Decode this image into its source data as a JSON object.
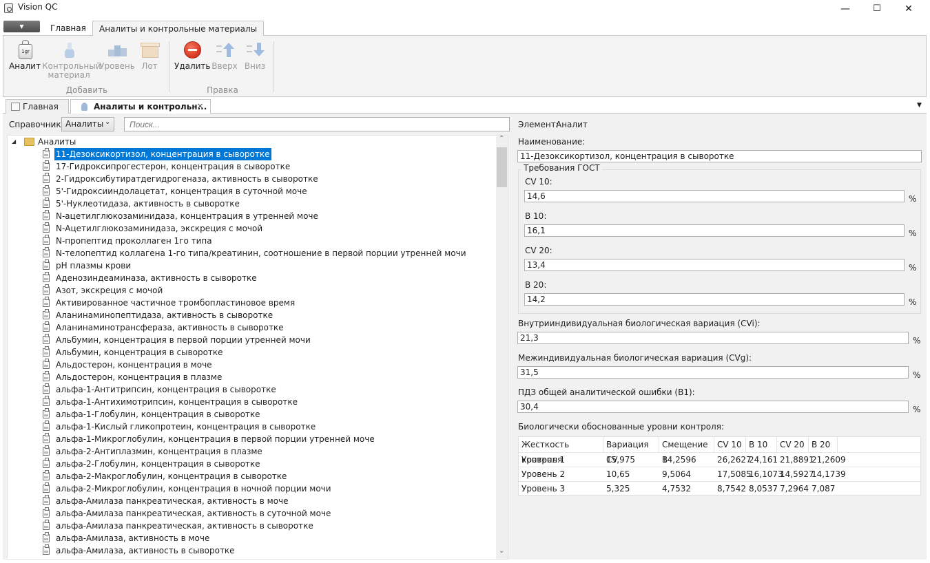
{
  "window": {
    "title": "Vision QC",
    "minimize": "—",
    "maximize": "☐",
    "close": "✕"
  },
  "ribbon": {
    "app_menu": "▼",
    "tabs": [
      "Главная",
      "Аналиты и контрольные материалы"
    ],
    "add_group": {
      "label": "Добавить",
      "buttons": {
        "analyte": "Аналит",
        "control_1": "Контрольный",
        "control_2": "материал",
        "level": "Уровень",
        "lot": "Лот"
      }
    },
    "edit_group": {
      "label": "Правка",
      "buttons": {
        "delete": "Удалить",
        "up": "Вверх",
        "down": "Вниз"
      }
    },
    "icon_text": "1gr"
  },
  "doc_tabs": {
    "home": "Главная",
    "analytes": "Аналиты и контрольн...",
    "close": "✕",
    "overflow": "▼"
  },
  "left": {
    "dict_label": "Справочник:",
    "dict_value": "Аналиты",
    "dict_arrow": "⌄",
    "search_placeholder": "Поиск...",
    "tree_root": "Аналиты",
    "tree_expander": "◢",
    "items": [
      "11-Дезоксикортизол, концентрация в сыворотке",
      "17-Гидроксипрогестерон, концентрация в сыворотке",
      "2-Гидроксибутиратдегидрогеназа, активность в сыворотке",
      "5'-Гидроксииндолацетат, концентрация в суточной моче",
      "5'-Нуклеотидаза, активность в сыворотке",
      "N-ацетилглюкозаминидаза, концентрация в утренней моче",
      "N-Ацетилглюкозаминидаза, экскреция с мочой",
      "N-пропептид проколлаген 1го типа",
      "N-телопептид коллагена 1-го  типа/креатинин, соотношение в первой порции утренней мочи",
      "pH плазмы крови",
      "Аденозиндеаминаза, активность в сыворотке",
      "Азот, экскреция с мочой",
      "Активированное частичное тромбопластиновое время",
      "Аланинаминопептидаза, активность в сыворотке",
      "Аланинаминотрансфераза, активность в сыворотке",
      "Альбумин, концентрация в первой порции утренней мочи",
      "Альбумин, концентрация в сыворотке",
      "Альдостерон, концентрация в моче",
      "Альдостерон, концентрация в плазме",
      "альфа-1-Антитрипсин, концентрация в сыворотке",
      "альфа-1-Антихимотрипсин, концентрация в сыворотке",
      "альфа-1-Глобулин, концентрация в сыворотке",
      "альфа-1-Кислый гликопротеин, концентрация в сыворотке",
      "альфа-1-Микроглобулин, концентрация в первой порции утренней моче",
      "альфа-2-Антиплазмин, концентрация в плазме",
      "альфа-2-Глобулин, концентрация в сыворотке",
      "альфа-2-Макроглобулин, концентрация в сыворотке",
      "альфа-2-Микроглобулин, концентрация в ночной порции мочи",
      "альфа-Амилаза панкреатическая, активность в моче",
      "альфа-Амилаза панкреатическая, активность в суточной моче",
      "альфа-Амилаза панкреатическая, активность в сыворотке",
      "альфа-Амилаза, активность в моче",
      "альфа-Амилаза, активность в сыворотке"
    ],
    "scroll_up": "⌃",
    "scroll_down": "⌄"
  },
  "right": {
    "element_label": "Элемент:",
    "element_value": "Аналит",
    "name_label": "Наименование:",
    "name_value": "11-Дезоксикортизол, концентрация в сыворотке",
    "gost_title": "Требования ГОСТ",
    "pct": "%",
    "cv10_label": "CV 10:",
    "cv10_value": "14,6",
    "b10_label": "B 10:",
    "b10_value": "16,1",
    "cv20_label": "CV 20:",
    "cv20_value": "13,4",
    "b20_label": "B 20:",
    "b20_value": "14,2",
    "cvi_label": "Внутрииндивидуальная биологическая вариация (CVi):",
    "cvi_value": "21,3",
    "cvg_label": "Межиндивидуальная биологическая вариация (CVg):",
    "cvg_value": "31,5",
    "b1_label": "ПДЗ общей аналитической ошибки (B1):",
    "b1_value": "30,4",
    "levels_label": "Биологически обоснованные уровни контроля:",
    "levels": {
      "headers": [
        "Жесткость контроля",
        "Вариация CV",
        "Смещение B",
        "CV 10",
        "B 10",
        "CV 20",
        "B 20"
      ],
      "rows": [
        [
          "Уровень 1",
          "15,975",
          "14,2596",
          "26,2627",
          "24,161",
          "21,8891",
          "21,2609"
        ],
        [
          "Уровень 2",
          "10,65",
          "9,5064",
          "17,5085",
          "16,1073",
          "14,5927",
          "14,1739"
        ],
        [
          "Уровень 3",
          "5,325",
          "4,7532",
          "8,7542",
          "8,0537",
          "7,2964",
          "7,087"
        ]
      ]
    }
  },
  "colors": {
    "selection": "#0078d7",
    "delete_red": "#d9341f",
    "arrow_blue": "#7fa7d8"
  }
}
